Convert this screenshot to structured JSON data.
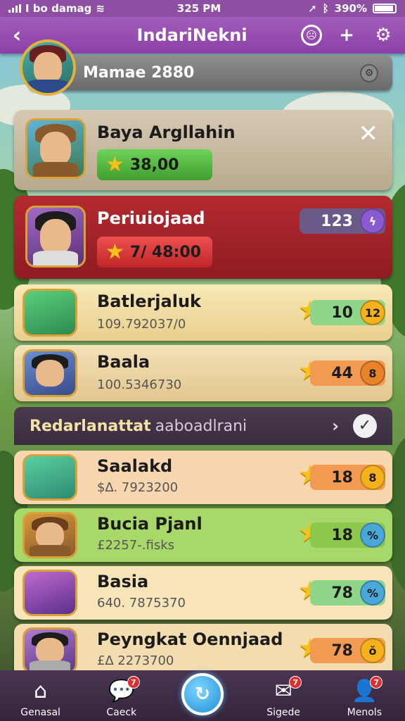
{
  "status_bar": {
    "carrier": "I bo damag",
    "time": "325 PM",
    "battery": "390%"
  },
  "header": {
    "title": "IndariNekni"
  },
  "profile": {
    "name": "Mamae 2880"
  },
  "featured": {
    "name": "Baya Argllahin",
    "amount": "38,00"
  },
  "selected": {
    "name": "Periuiojaad",
    "amount": "7/ 48:00",
    "score": "123"
  },
  "rows_top": [
    {
      "name": "Batlerjaluk",
      "sub": "109.792037/0",
      "score": "10",
      "coin": "12",
      "coin_color": "#f5b21c"
    },
    {
      "name": "Baala",
      "sub": "100.5346730",
      "score": "44",
      "coin": "8",
      "coin_color": "#e8832a"
    }
  ],
  "section": {
    "title": "Redarlanattat",
    "subtitle": "aaboadlrani"
  },
  "rows_bottom": [
    {
      "name": "Saalakd",
      "sub": "$∆. 7923200",
      "score": "18",
      "coin": "8",
      "coin_color": "#f5b21c",
      "bg": "#f7d6b0",
      "score_bg": "#f29a52"
    },
    {
      "name": "Bucia Pjanl",
      "sub": "£2257-.fisks",
      "score": "18",
      "coin": "%",
      "coin_color": "#4aa8d8",
      "bg": "#a8d86a",
      "score_bg": "#8cc84c"
    },
    {
      "name": "Basia",
      "sub": "640. 7875370",
      "score": "78",
      "coin": "%",
      "coin_color": "#4aa8d8",
      "bg": "#f7e4b8",
      "score_bg": "#8fd68a"
    },
    {
      "name": "Peyngkat Oennjaad",
      "sub": "£∆ 2273700",
      "score": "78",
      "coin": "ŏ",
      "coin_color": "#f5b21c",
      "bg": "#f3dcb0",
      "score_bg": "#f29a52"
    }
  ],
  "nav": {
    "home": "Genasal",
    "check": "Caeck",
    "signed": "Sigede",
    "menu": "Menols",
    "check_badge": "7",
    "signed_badge": "7",
    "menu_badge": "7"
  },
  "colors": {
    "header": "#8a3fa6",
    "selected_card": "#a5242a",
    "green_button": "#52b83e",
    "red_button": "#d9383a"
  }
}
